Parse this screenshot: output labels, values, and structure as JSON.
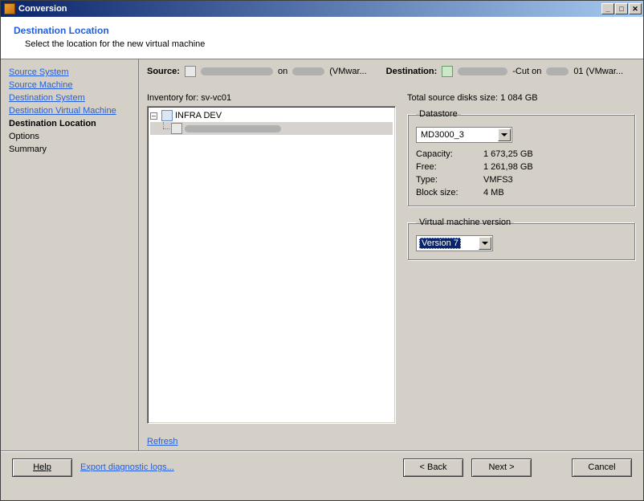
{
  "window": {
    "title": "Conversion"
  },
  "header": {
    "title": "Destination Location",
    "subtitle": "Select the location for the new virtual machine"
  },
  "sidebar": {
    "items": [
      {
        "label": "Source System",
        "type": "link"
      },
      {
        "label": "Source Machine",
        "type": "link"
      },
      {
        "label": "Destination System",
        "type": "link"
      },
      {
        "label": "Destination Virtual Machine",
        "type": "link"
      },
      {
        "label": "Destination Location",
        "type": "bold"
      },
      {
        "label": "Options",
        "type": "plain"
      },
      {
        "label": "Summary",
        "type": "plain"
      }
    ]
  },
  "srcdst": {
    "source_label": "Source:",
    "source_text_on": " on ",
    "source_suffix": " (VMwar...",
    "dest_label": "Destination:",
    "dest_text_cut": "-Cut on",
    "dest_suffix": "01 (VMwar..."
  },
  "inventory": {
    "label": "Inventory for:  sv-vc01",
    "root": "INFRA DEV"
  },
  "refresh": "Refresh",
  "totals": {
    "label": "Total source disks size:  1 084 GB"
  },
  "datastore": {
    "legend": "Datastore",
    "selected": "MD3000_3",
    "rows": {
      "capacity_k": "Capacity:",
      "capacity_v": "1 673,25 GB",
      "free_k": "Free:",
      "free_v": "1 261,98 GB",
      "type_k": "Type:",
      "type_v": "VMFS3",
      "block_k": "Block size:",
      "block_v": "4 MB"
    }
  },
  "vmversion": {
    "legend": "Virtual machine version",
    "selected": "Version 7"
  },
  "footer": {
    "help": "Help",
    "export": "Export diagnostic logs...",
    "back": "< Back",
    "next": "Next >",
    "cancel": "Cancel"
  }
}
